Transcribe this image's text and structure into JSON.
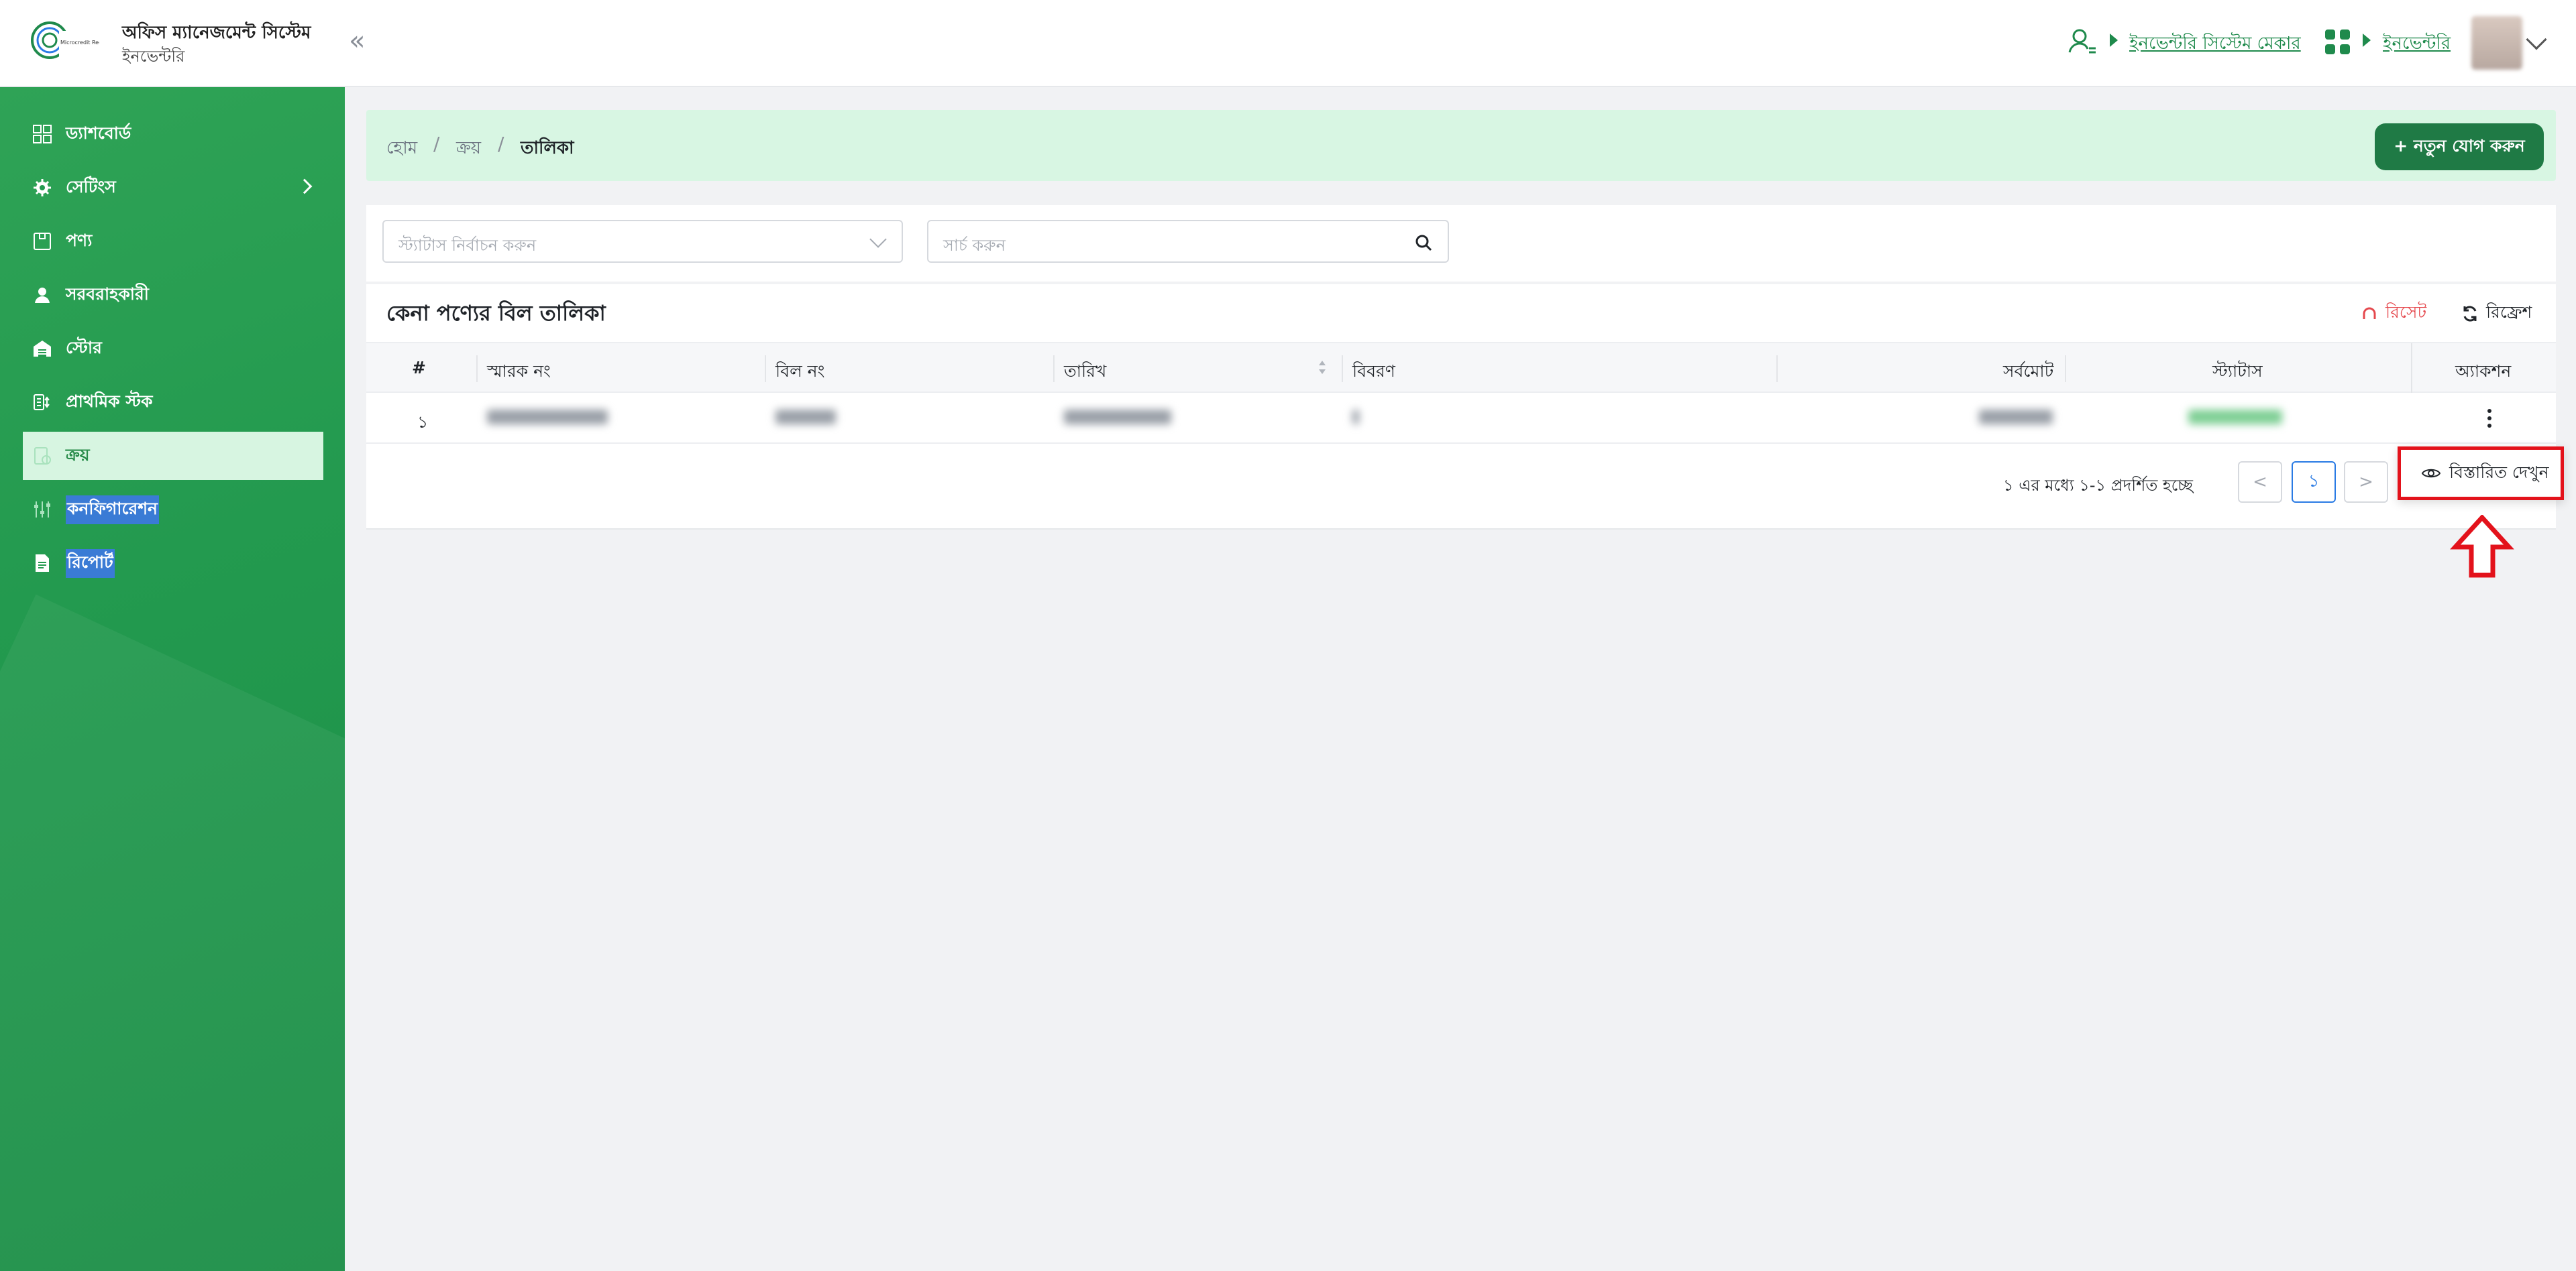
{
  "header": {
    "brand_title": "অফিস ম্যানেজমেন্ট সিস্টেম",
    "brand_sub": "ইনভেন্টরি",
    "logo_text": "Microcredit Regulatory Authority",
    "user_role_link": "ইনভেন্টরি সিস্টেম মেকার",
    "module_link": "ইনভেন্টরি",
    "accent": "#1f8a4c"
  },
  "sidebar": {
    "items": [
      {
        "label": "ড্যাশবোর্ড",
        "icon": "dashboard-grid-icon"
      },
      {
        "label": "সেটিংস",
        "icon": "gear-icon"
      },
      {
        "label": "পণ্য",
        "icon": "product-box-icon"
      },
      {
        "label": "সরবরাহকারী",
        "icon": "supplier-icon"
      },
      {
        "label": "স্টোর",
        "icon": "store-icon"
      },
      {
        "label": "প্রাথমিক স্টক",
        "icon": "stock-icon"
      },
      {
        "label": "ক্রয়",
        "icon": "purchase-icon"
      },
      {
        "label": "কনফিগারেশন",
        "icon": "sliders-icon"
      },
      {
        "label": "রিপোর্ট",
        "icon": "report-icon"
      }
    ],
    "active_index": 6,
    "color": "#23994e"
  },
  "breadcrumb": {
    "items": [
      "হোম",
      "ক্রয়",
      "তালিকা"
    ],
    "add_button": "+ নতুন যোগ করুন"
  },
  "filters": {
    "status_placeholder": "স্ট্যাটাস নির্বাচন করুন",
    "search_placeholder": "সার্চ করুন"
  },
  "table": {
    "title": "কেনা পণ্যের বিল তালিকা",
    "reset_label": "রিসেট",
    "refresh_label": "রিফ্রেশ",
    "columns": [
      "#",
      "স্মারক নং",
      "বিল নং",
      "তারিখ",
      "বিবরণ",
      "সর্বমোট",
      "স্ট্যাটাস",
      "অ্যাকশন"
    ],
    "rows": [
      {
        "index": "১"
      }
    ]
  },
  "pagination": {
    "info": "১ এর মধ্যে ১-১ প্রদর্শিত হচ্ছে",
    "current_page": "১",
    "prev": "<",
    "next": ">"
  },
  "action_menu": {
    "view_details": "বিস্তারিত দেখুন"
  }
}
